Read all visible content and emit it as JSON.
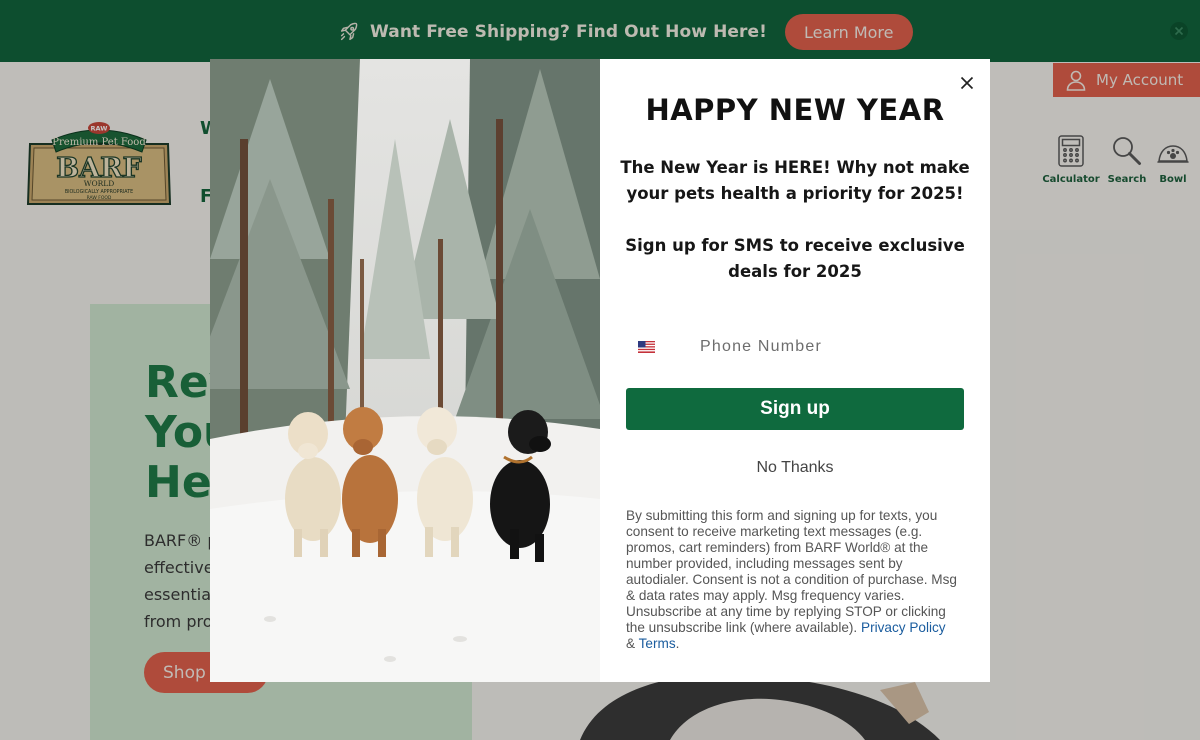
{
  "announcement": {
    "text": "Want Free Shipping? Find Out How Here!",
    "button_label": "Learn More"
  },
  "header": {
    "logo": {
      "badge": "RAW",
      "ribbon": "Premium Pet Food",
      "brand": "BARF",
      "world": "WORLD",
      "tagline_1": "BIOLOGICALLY APPROPRIATE",
      "tagline_2": "RAW FOOD"
    },
    "nav_partial_1": "W",
    "nav_partial_2": "F",
    "account_label": "My Account",
    "tools": [
      {
        "label": "Calculator",
        "icon": "calculator-icon"
      },
      {
        "label": "Search",
        "icon": "search-icon"
      },
      {
        "label": "Bowl",
        "icon": "bowl-icon"
      }
    ]
  },
  "hero": {
    "title_lines": [
      "Rev",
      "You",
      "He"
    ],
    "body_lines": [
      "BARF® p",
      "effective,",
      "essential",
      "from pro"
    ],
    "button_label": "Shop"
  },
  "modal": {
    "title": "HAPPY NEW YEAR",
    "subtitle": "The New Year is HERE! Why not make your pets health a priority for 2025!",
    "subtitle2": "Sign up for SMS to receive exclusive deals for 2025",
    "phone_placeholder": "Phone Number",
    "country_flag": "US",
    "signup_label": "Sign up",
    "no_thanks_label": "No Thanks",
    "legal_text": "By submitting this form and signing up for texts, you consent to receive marketing text messages (e.g. promos, cart reminders) from BARF World® at the number provided, including messages sent by autodialer. Consent is not a condition of purchase. Msg & data rates may apply. Msg frequency varies. Unsubscribe at any time by replying STOP or clicking the unsubscribe link (where available).",
    "privacy_label": "Privacy Policy",
    "amp": "&",
    "terms_label": "Terms",
    "period": "."
  },
  "colors": {
    "brand_green": "#11653d",
    "accent_coral": "#e0604c",
    "signup_green": "#0f6a3e",
    "link_blue": "#1a5c9e"
  }
}
